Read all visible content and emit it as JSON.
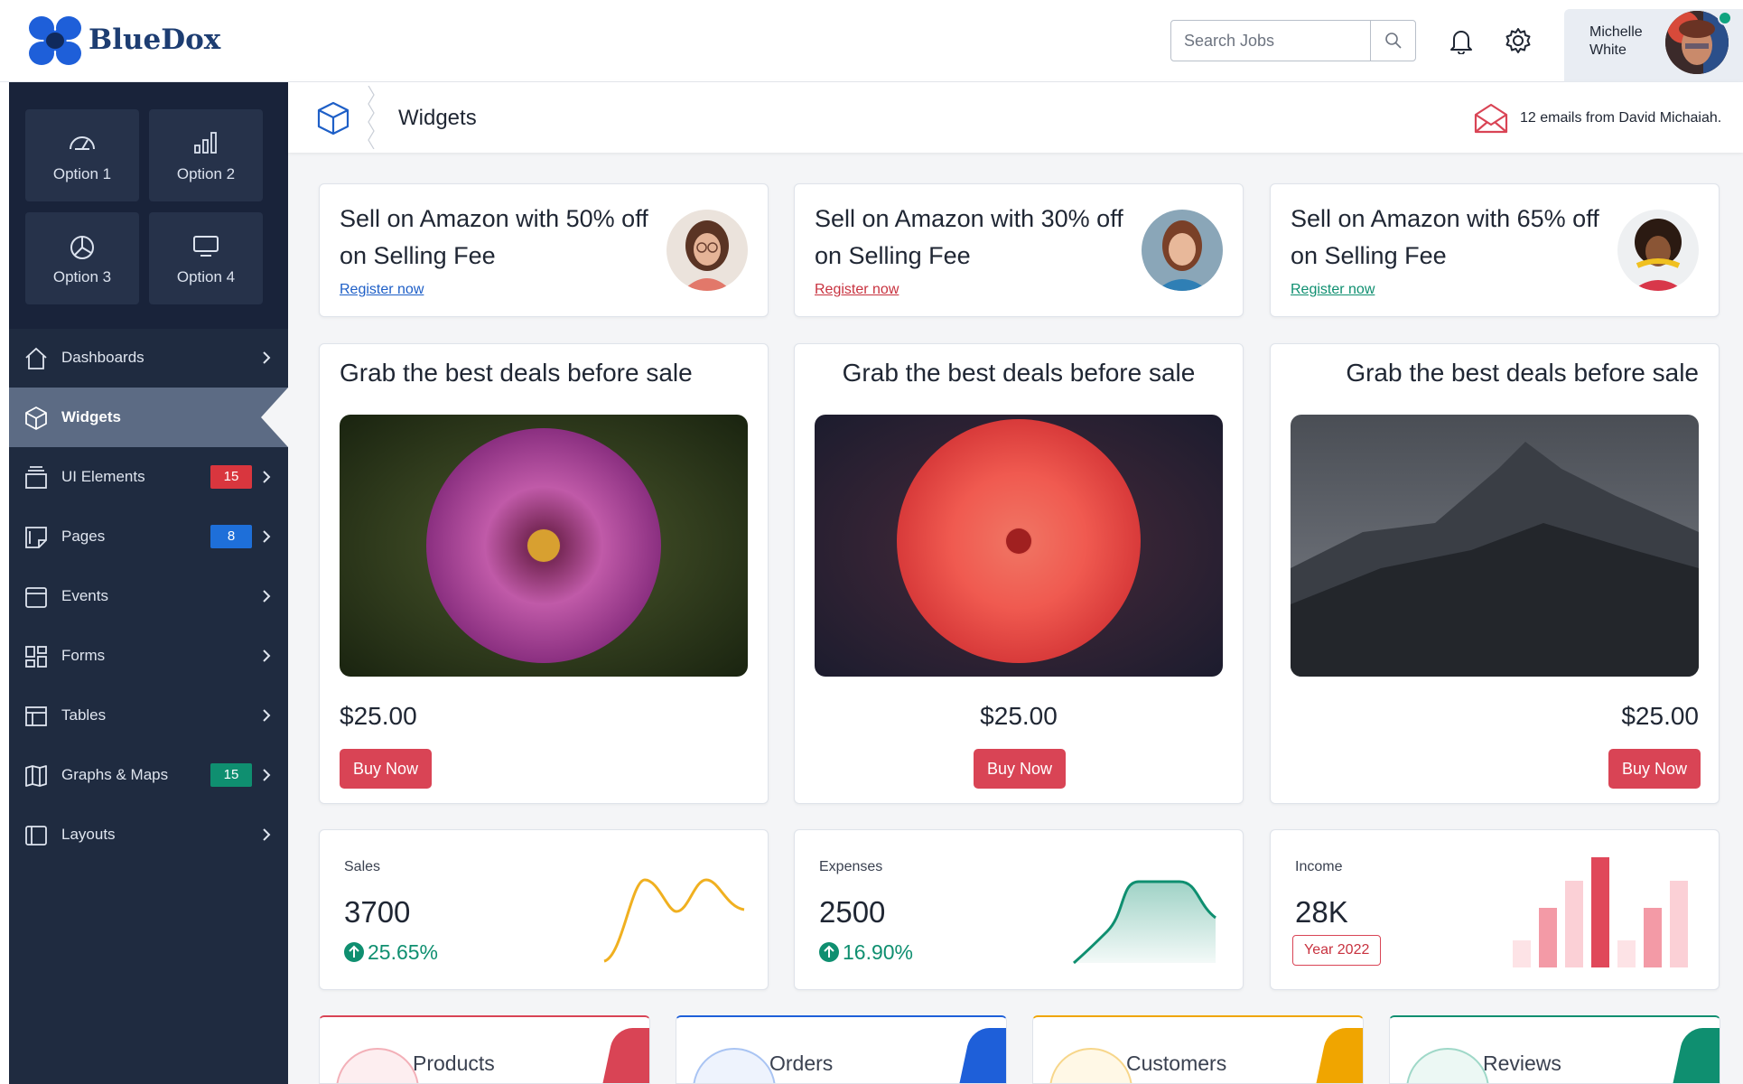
{
  "brand": {
    "name": "BlueDox"
  },
  "header": {
    "search_placeholder": "Search Jobs",
    "user_name": "Michelle White"
  },
  "sidebar": {
    "quick": [
      {
        "label": "Option 1",
        "icon": "gauge-icon"
      },
      {
        "label": "Option 2",
        "icon": "bar-chart-icon"
      },
      {
        "label": "Option 3",
        "icon": "pie-chart-icon"
      },
      {
        "label": "Option 4",
        "icon": "monitor-icon"
      }
    ],
    "items": [
      {
        "label": "Dashboards",
        "icon": "home-icon"
      },
      {
        "label": "Widgets",
        "icon": "cube-icon",
        "active": true
      },
      {
        "label": "UI Elements",
        "icon": "layers-icon",
        "badge": "15",
        "badge_color": "#d9363e"
      },
      {
        "label": "Pages",
        "icon": "pages-icon",
        "badge": "8",
        "badge_color": "#1e6fd9"
      },
      {
        "label": "Events",
        "icon": "calendar-icon"
      },
      {
        "label": "Forms",
        "icon": "grid-icon"
      },
      {
        "label": "Tables",
        "icon": "table-icon"
      },
      {
        "label": "Graphs & Maps",
        "icon": "map-icon",
        "badge": "15",
        "badge_color": "#0f8f70"
      },
      {
        "label": "Layouts",
        "icon": "layout-icon"
      }
    ]
  },
  "page": {
    "title": "Widgets",
    "notice": "12 emails from David Michaiah."
  },
  "promos": [
    {
      "text": "Sell on Amazon with 50% off on Selling Fee",
      "link": "Register now",
      "link_color": "#1e5fc7"
    },
    {
      "text": "Sell on Amazon with 30% off on Selling Fee",
      "link": "Register now",
      "link_color": "#c8323f"
    },
    {
      "text": "Sell on Amazon with 65% off on Selling Fee",
      "link": "Register now",
      "link_color": "#0f8f70"
    }
  ],
  "deals": [
    {
      "title": "Grab the best deals before sale",
      "price": "$25.00",
      "button": "Buy Now",
      "align": "left"
    },
    {
      "title": "Grab the best deals before sale",
      "price": "$25.00",
      "button": "Buy Now",
      "align": "center"
    },
    {
      "title": "Grab the best deals before sale",
      "price": "$25.00",
      "button": "Buy Now",
      "align": "right"
    }
  ],
  "stats": [
    {
      "label": "Sales",
      "value": "3700",
      "change": "25.65%"
    },
    {
      "label": "Expenses",
      "value": "2500",
      "change": "16.90%"
    },
    {
      "label": "Income",
      "value": "28K",
      "badge": "Year 2022"
    }
  ],
  "mini_cards": [
    {
      "label": "Products",
      "color": "#d94455"
    },
    {
      "label": "Orders",
      "color": "#1e5fd9"
    },
    {
      "label": "Customers",
      "color": "#f0a500"
    },
    {
      "label": "Reviews",
      "color": "#0f8f70"
    }
  ],
  "colors": {
    "accent": "#d94455",
    "sidebar": "#1f2b40",
    "success": "#0f8f70"
  }
}
